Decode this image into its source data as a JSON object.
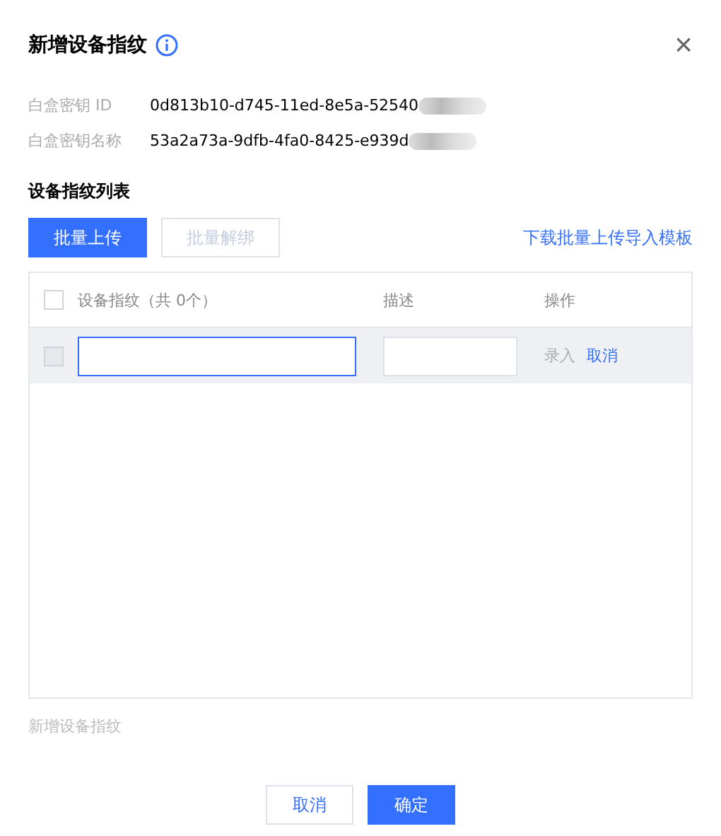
{
  "dialog": {
    "title": "新增设备指纹",
    "close": "×"
  },
  "info": [
    {
      "label": "白盒密钥 ID",
      "value": "0d813b10-d745-11ed-8e5a-52540"
    },
    {
      "label": "白盒密钥名称",
      "value": "53a2a73a-9dfb-4fa0-8425-e939d"
    }
  ],
  "section_title": "设备指纹列表",
  "toolbar": {
    "buttons": [
      {
        "label": "批量上传",
        "kind": "primary",
        "disabled": false
      },
      {
        "label": "批量解绑",
        "kind": "default",
        "disabled": true
      }
    ],
    "link": "下载批量上传导入模板"
  },
  "table": {
    "columns": [
      "设备指纹（共 0个）",
      "描述",
      "操作"
    ],
    "header_checked": false,
    "edit_row": {
      "checked": false,
      "disabled": true,
      "fingerprint_focused": true,
      "actions": [
        {
          "label": "录入",
          "disabled": true
        },
        {
          "label": "取消",
          "disabled": false
        }
      ]
    }
  },
  "add_link": {
    "label": "新增设备指纹",
    "disabled": true
  },
  "footer": [
    {
      "label": "取消",
      "kind": "default"
    },
    {
      "label": "确定",
      "kind": "primary"
    }
  ]
}
